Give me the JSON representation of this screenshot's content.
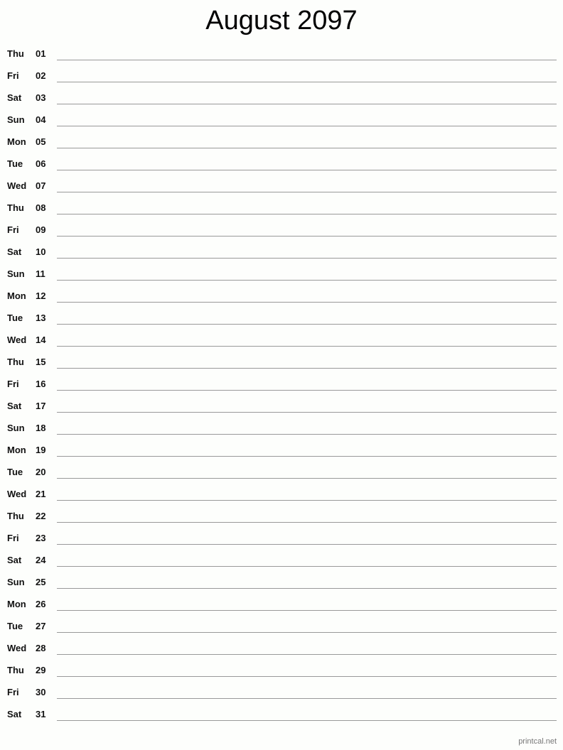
{
  "title": "August 2097",
  "days": [
    {
      "dow": "Thu",
      "num": "01"
    },
    {
      "dow": "Fri",
      "num": "02"
    },
    {
      "dow": "Sat",
      "num": "03"
    },
    {
      "dow": "Sun",
      "num": "04"
    },
    {
      "dow": "Mon",
      "num": "05"
    },
    {
      "dow": "Tue",
      "num": "06"
    },
    {
      "dow": "Wed",
      "num": "07"
    },
    {
      "dow": "Thu",
      "num": "08"
    },
    {
      "dow": "Fri",
      "num": "09"
    },
    {
      "dow": "Sat",
      "num": "10"
    },
    {
      "dow": "Sun",
      "num": "11"
    },
    {
      "dow": "Mon",
      "num": "12"
    },
    {
      "dow": "Tue",
      "num": "13"
    },
    {
      "dow": "Wed",
      "num": "14"
    },
    {
      "dow": "Thu",
      "num": "15"
    },
    {
      "dow": "Fri",
      "num": "16"
    },
    {
      "dow": "Sat",
      "num": "17"
    },
    {
      "dow": "Sun",
      "num": "18"
    },
    {
      "dow": "Mon",
      "num": "19"
    },
    {
      "dow": "Tue",
      "num": "20"
    },
    {
      "dow": "Wed",
      "num": "21"
    },
    {
      "dow": "Thu",
      "num": "22"
    },
    {
      "dow": "Fri",
      "num": "23"
    },
    {
      "dow": "Sat",
      "num": "24"
    },
    {
      "dow": "Sun",
      "num": "25"
    },
    {
      "dow": "Mon",
      "num": "26"
    },
    {
      "dow": "Tue",
      "num": "27"
    },
    {
      "dow": "Wed",
      "num": "28"
    },
    {
      "dow": "Thu",
      "num": "29"
    },
    {
      "dow": "Fri",
      "num": "30"
    },
    {
      "dow": "Sat",
      "num": "31"
    }
  ],
  "footer": "printcal.net"
}
